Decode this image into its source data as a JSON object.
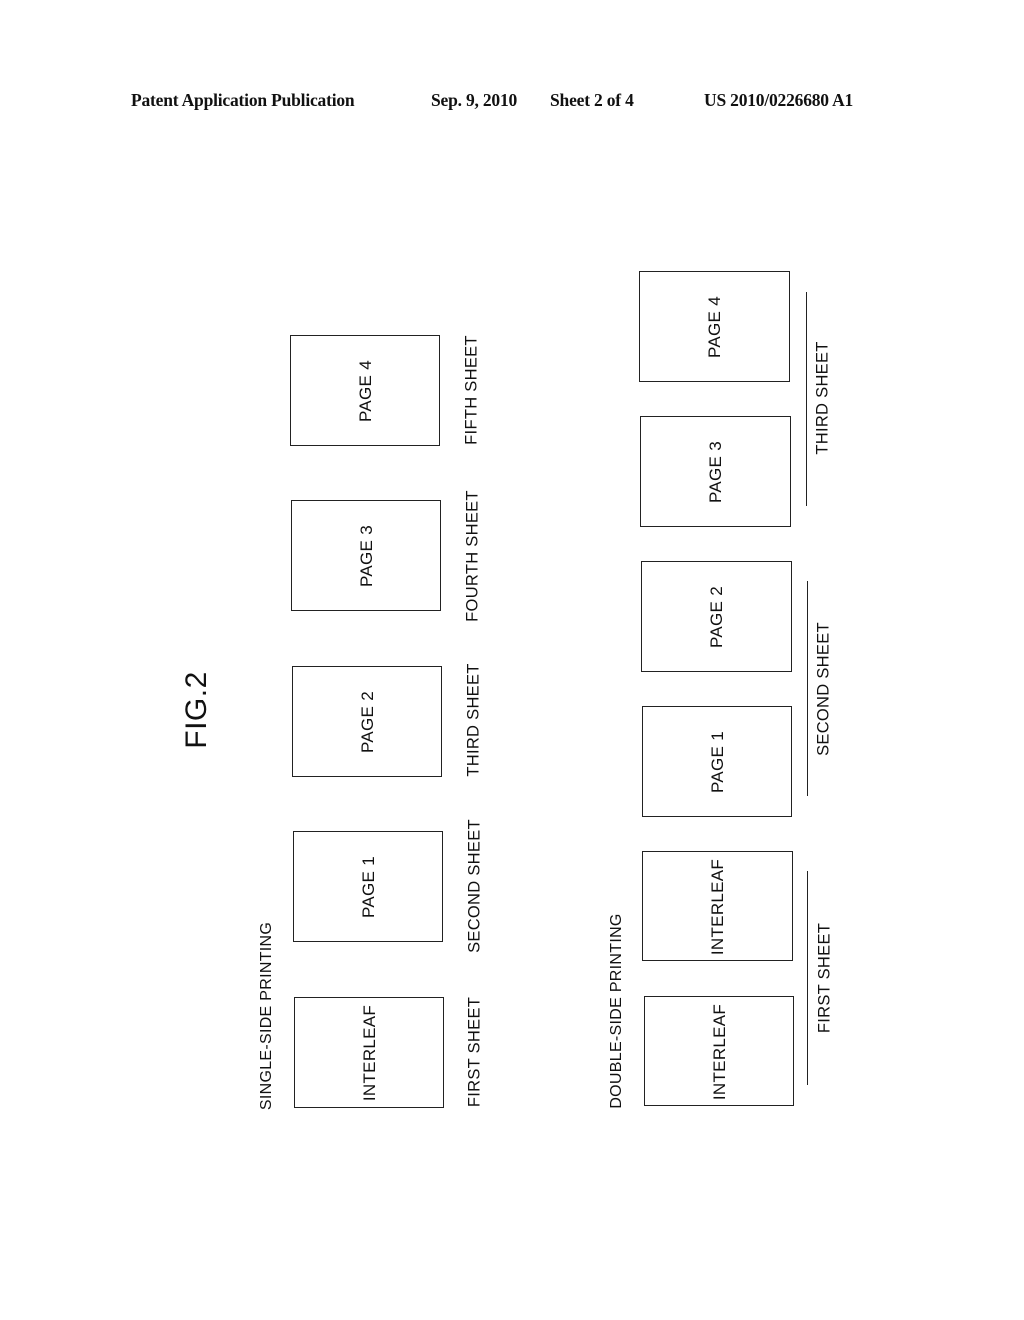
{
  "header": {
    "publication": "Patent Application Publication",
    "date": "Sep. 9, 2010",
    "sheet": "Sheet 2 of 4",
    "number": "US 2010/0226680 A1"
  },
  "figure": {
    "label": "FIG.2",
    "single_side": {
      "title": "SINGLE-SIDE PRINTING",
      "sheets": [
        {
          "box": "INTERLEAF",
          "label": "FIRST SHEET"
        },
        {
          "box": "PAGE 1",
          "label": "SECOND SHEET"
        },
        {
          "box": "PAGE 2",
          "label": "THIRD SHEET"
        },
        {
          "box": "PAGE 3",
          "label": "FOURTH SHEET"
        },
        {
          "box": "PAGE 4",
          "label": "FIFTH SHEET"
        }
      ]
    },
    "double_side": {
      "title": "DOUBLE-SIDE PRINTING",
      "boxes": [
        "INTERLEAF",
        "INTERLEAF",
        "PAGE 1",
        "PAGE 2",
        "PAGE 3",
        "PAGE 4"
      ],
      "sheets": [
        {
          "label": "FIRST SHEET",
          "pages": [
            "INTERLEAF",
            "INTERLEAF"
          ]
        },
        {
          "label": "SECOND SHEET",
          "pages": [
            "PAGE 1",
            "PAGE 2"
          ]
        },
        {
          "label": "THIRD SHEET",
          "pages": [
            "PAGE 3",
            "PAGE 4"
          ]
        }
      ]
    }
  }
}
